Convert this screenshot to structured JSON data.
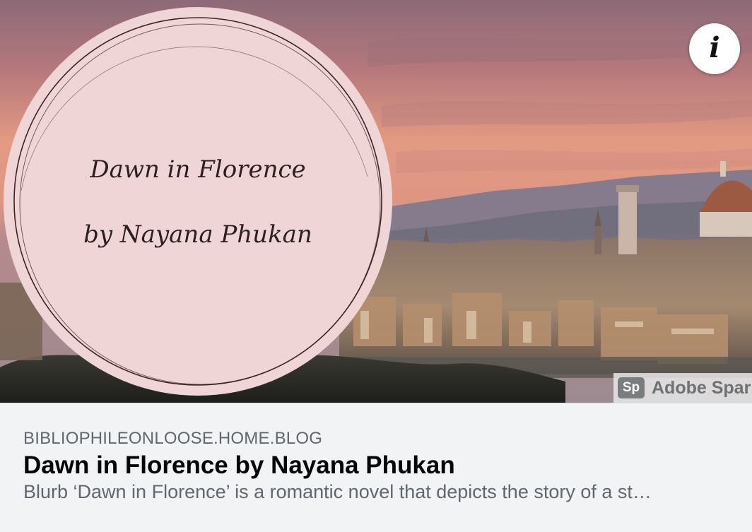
{
  "link_preview": {
    "image": {
      "overlay_title_line1": "Dawn in Florence",
      "overlay_title_line2": "by Nayana Phukan",
      "info_icon": "info-icon",
      "watermark": {
        "badge": "Sp",
        "text": "Adobe Spar"
      }
    },
    "domain": "BIBLIOPHILEONLOOSE.HOME.BLOG",
    "title": "Dawn in Florence by Nayana Phukan",
    "description": "Blurb ‘Dawn in Florence’ is a romantic novel that depicts the story of a st…"
  },
  "colors": {
    "sky_top": "#8f6b78",
    "sky_glow": "#e9987e",
    "circle_fill": "#efd6d6",
    "title_text": "#050505",
    "meta_text": "#606770",
    "meta_bg": "#f2f3f5"
  }
}
